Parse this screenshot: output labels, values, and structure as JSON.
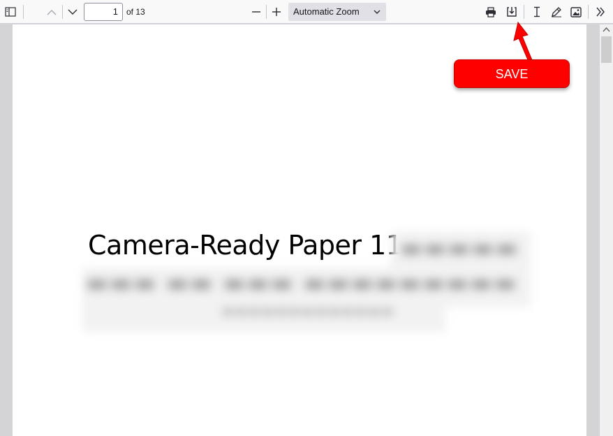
{
  "toolbar": {
    "sidebar_toggle_icon": "sidebar-toggle-icon",
    "prev_page_icon": "chevron-up-icon",
    "next_page_icon": "chevron-down-icon",
    "page_number": "1",
    "page_count": "of 13",
    "zoom_out_icon": "minus-icon",
    "zoom_in_icon": "plus-icon",
    "zoom_value": "Automatic Zoom",
    "print_icon": "print-icon",
    "save_icon": "download-icon",
    "text_tool_icon": "text-cursor-icon",
    "draw_icon": "pencil-icon",
    "image_icon": "image-icon",
    "more_tools_icon": "double-chevron-right-icon"
  },
  "document": {
    "title": "Camera-Ready Paper 11"
  },
  "annotation": {
    "save_label": "SAVE",
    "color": "#ff0000"
  }
}
